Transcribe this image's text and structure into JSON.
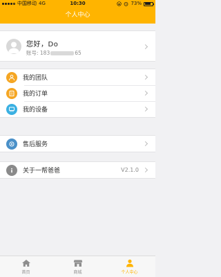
{
  "status_bar": {
    "carrier": "中国移动",
    "network": "4G",
    "time": "10:30",
    "battery": "73%",
    "battery_level": 0.73
  },
  "nav": {
    "title": "个人中心"
  },
  "profile": {
    "greeting": "您好，Do",
    "account_prefix": "账号: 183",
    "account_suffix": "65"
  },
  "menu": {
    "team": {
      "label": "我的团队",
      "icon": "team-icon",
      "color": "#f5a623"
    },
    "orders": {
      "label": "我的订单",
      "icon": "orders-icon",
      "color": "#f5a623"
    },
    "devices": {
      "label": "我的设备",
      "icon": "device-icon",
      "color": "#3ab0e2"
    },
    "service": {
      "label": "售后服务",
      "icon": "service-icon",
      "color": "#4a90c8"
    },
    "about": {
      "label": "关于一帮爸爸",
      "icon": "info-icon",
      "color": "#8a8a8a",
      "version": "V2.1.0"
    }
  },
  "tabs": [
    {
      "label": "首页",
      "icon": "home-icon",
      "active": false
    },
    {
      "label": "商城",
      "icon": "store-icon",
      "active": false
    },
    {
      "label": "个人中心",
      "icon": "person-icon",
      "active": true
    }
  ],
  "colors": {
    "accent": "#ffb400",
    "background": "#f1f1f3"
  }
}
